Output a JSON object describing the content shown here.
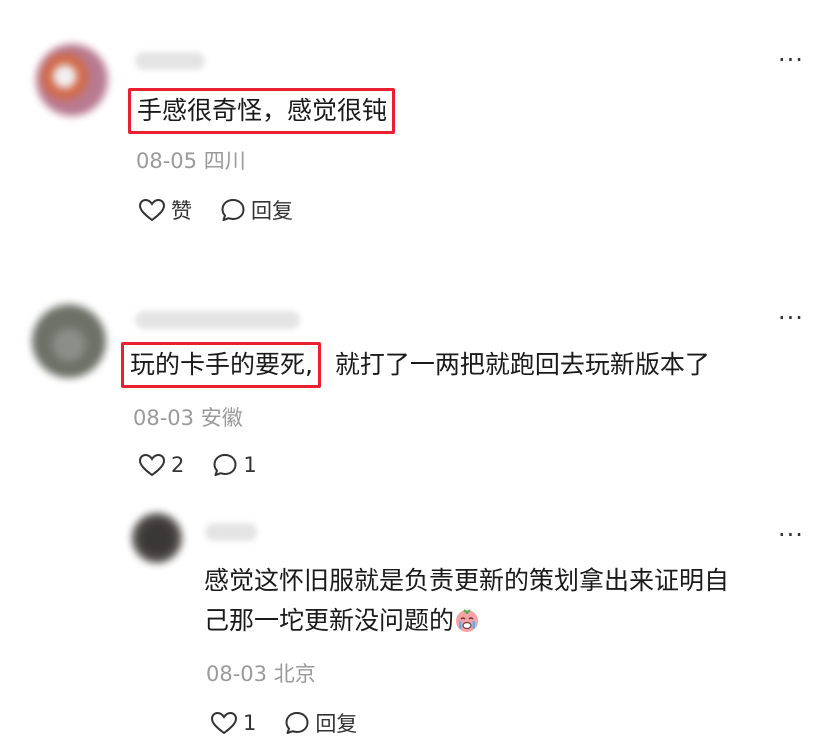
{
  "comments": [
    {
      "text_highlighted": "手感很奇怪，感觉很钝",
      "text_rest": "",
      "date": "08-05",
      "location": "四川",
      "like_label": "赞",
      "reply_label": "回复"
    },
    {
      "text_highlighted": "玩的卡手的要死,",
      "text_rest": "就打了一两把就跑回去玩新版本了",
      "date": "08-03",
      "location": "安徽",
      "like_label": "2",
      "reply_label": "1"
    }
  ],
  "reply": {
    "text_line1": "感觉这怀旧服就是负责更新的策划拿出来证明自",
    "text_line2": "己那一坨更新没问题的",
    "emoji": "crying-face-emoji",
    "date": "08-03",
    "location": "北京",
    "like_label": "1",
    "reply_label": "回复"
  },
  "more_label": "···",
  "colors": {
    "highlight_border": "#e8202f",
    "meta_text": "#9a9a9a",
    "body_text": "#1a1a1a"
  }
}
